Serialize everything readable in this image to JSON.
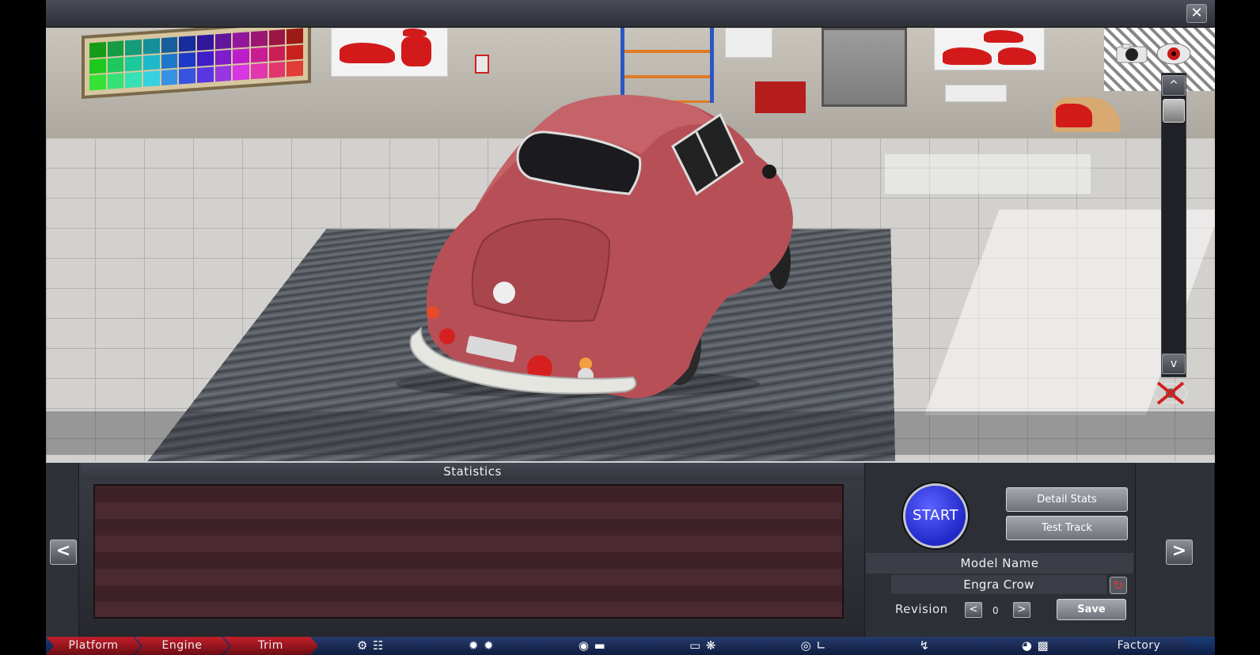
{
  "window": {
    "close_symbol": "✕"
  },
  "viewport": {
    "scroll_up": "^",
    "scroll_down": "v"
  },
  "stats": {
    "title": "Statistics"
  },
  "controls": {
    "prev": "<",
    "next": ">",
    "start_label": "START",
    "detail_stats_label": "Detail Stats",
    "test_track_label": "Test Track",
    "model_name_title": "Model Name",
    "model_name_value": "Engra Crow",
    "revision_label": "Revision",
    "revision_value": "0",
    "rev_prev": "<",
    "rev_next": ">",
    "save_label": "Save"
  },
  "tabs": [
    {
      "label": "Platform",
      "active": true
    },
    {
      "label": "Engine",
      "active": true
    },
    {
      "label": "Trim",
      "active": true
    },
    {
      "icons": [
        "gear-icon",
        "gearbox-icon"
      ]
    },
    {
      "icons": [
        "wheel-icon",
        "suspension-icon"
      ]
    },
    {
      "icons": [
        "brake-icon",
        "body-icon"
      ]
    },
    {
      "icons": [
        "car-icon",
        "fan-icon"
      ]
    },
    {
      "icons": [
        "steering-wheel-icon",
        "seat-icon"
      ]
    },
    {
      "icons": [
        "spring-icon"
      ]
    },
    {
      "icons": [
        "gauge-icon",
        "checkered-flag-icon"
      ]
    },
    {
      "label": "Factory"
    }
  ],
  "colors": {
    "active_tab": "#c41e2a",
    "inactive_tab": "#1c3d7a",
    "start_button": "#2f36e0",
    "car_body": "#b65056",
    "stats_background": "#43242a"
  }
}
